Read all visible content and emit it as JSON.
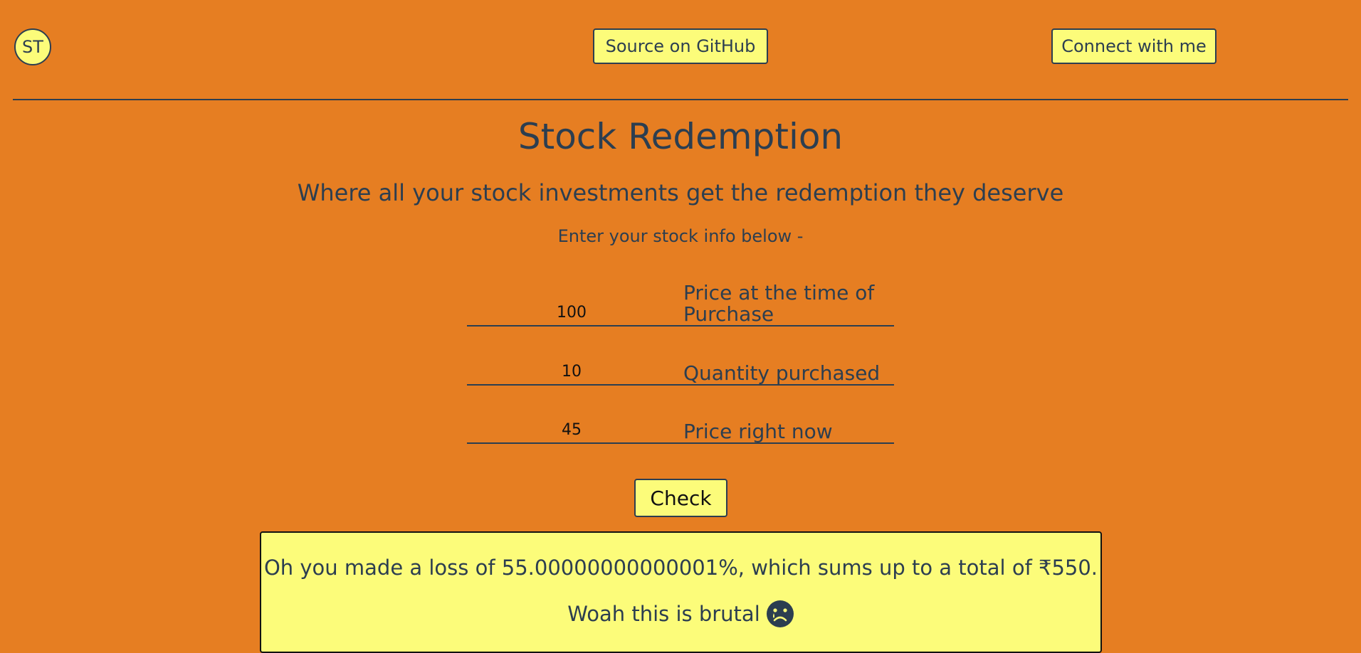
{
  "header": {
    "avatar_initials": "ST",
    "source_label": "Source on GitHub",
    "connect_label": "Connect with me"
  },
  "main": {
    "title": "Stock Redemption",
    "subtitle": "Where all your stock investments get the redemption they deserve",
    "instructions": "Enter your stock info below -"
  },
  "form": {
    "purchase_price": {
      "value": "100",
      "label": "Price at the time of Purchase"
    },
    "quantity": {
      "value": "10",
      "label": "Quantity purchased"
    },
    "current_price": {
      "value": "45",
      "label": "Price right now"
    },
    "check_label": "Check"
  },
  "output": {
    "message": "Oh you made a loss of 55.00000000000001%, which sums up to a total of ₹550.",
    "remark": "Woah this is brutal",
    "remark_icon": "sad-face-icon"
  },
  "colors": {
    "background": "#e67e22",
    "accent": "#fcfc7a",
    "text": "#2c3e50"
  }
}
